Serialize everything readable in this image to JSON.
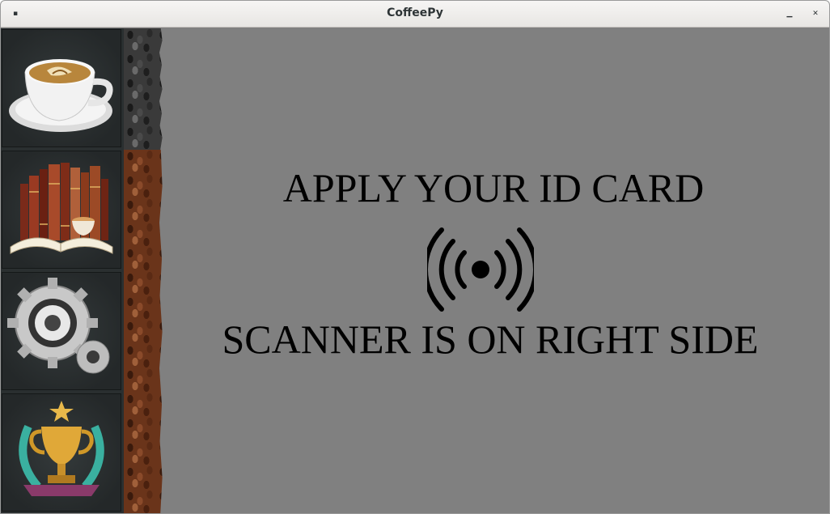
{
  "window": {
    "title": "CoffeePy",
    "menu_glyph": "▪",
    "minimize_glyph": "▁",
    "close_glyph": "✕"
  },
  "sidebar": {
    "items": [
      {
        "icon": "coffee-cup-icon"
      },
      {
        "icon": "books-icon"
      },
      {
        "icon": "gears-icon"
      },
      {
        "icon": "trophy-icon"
      }
    ]
  },
  "main": {
    "prompt_line1": "APPLY YOUR ID CARD",
    "prompt_icon": "nfc-signal-icon",
    "prompt_line2": "SCANNER IS ON RIGHT SIDE"
  },
  "colors": {
    "background": "#808080",
    "text": "#000000",
    "sidebar_tile": "#2a2f30"
  }
}
